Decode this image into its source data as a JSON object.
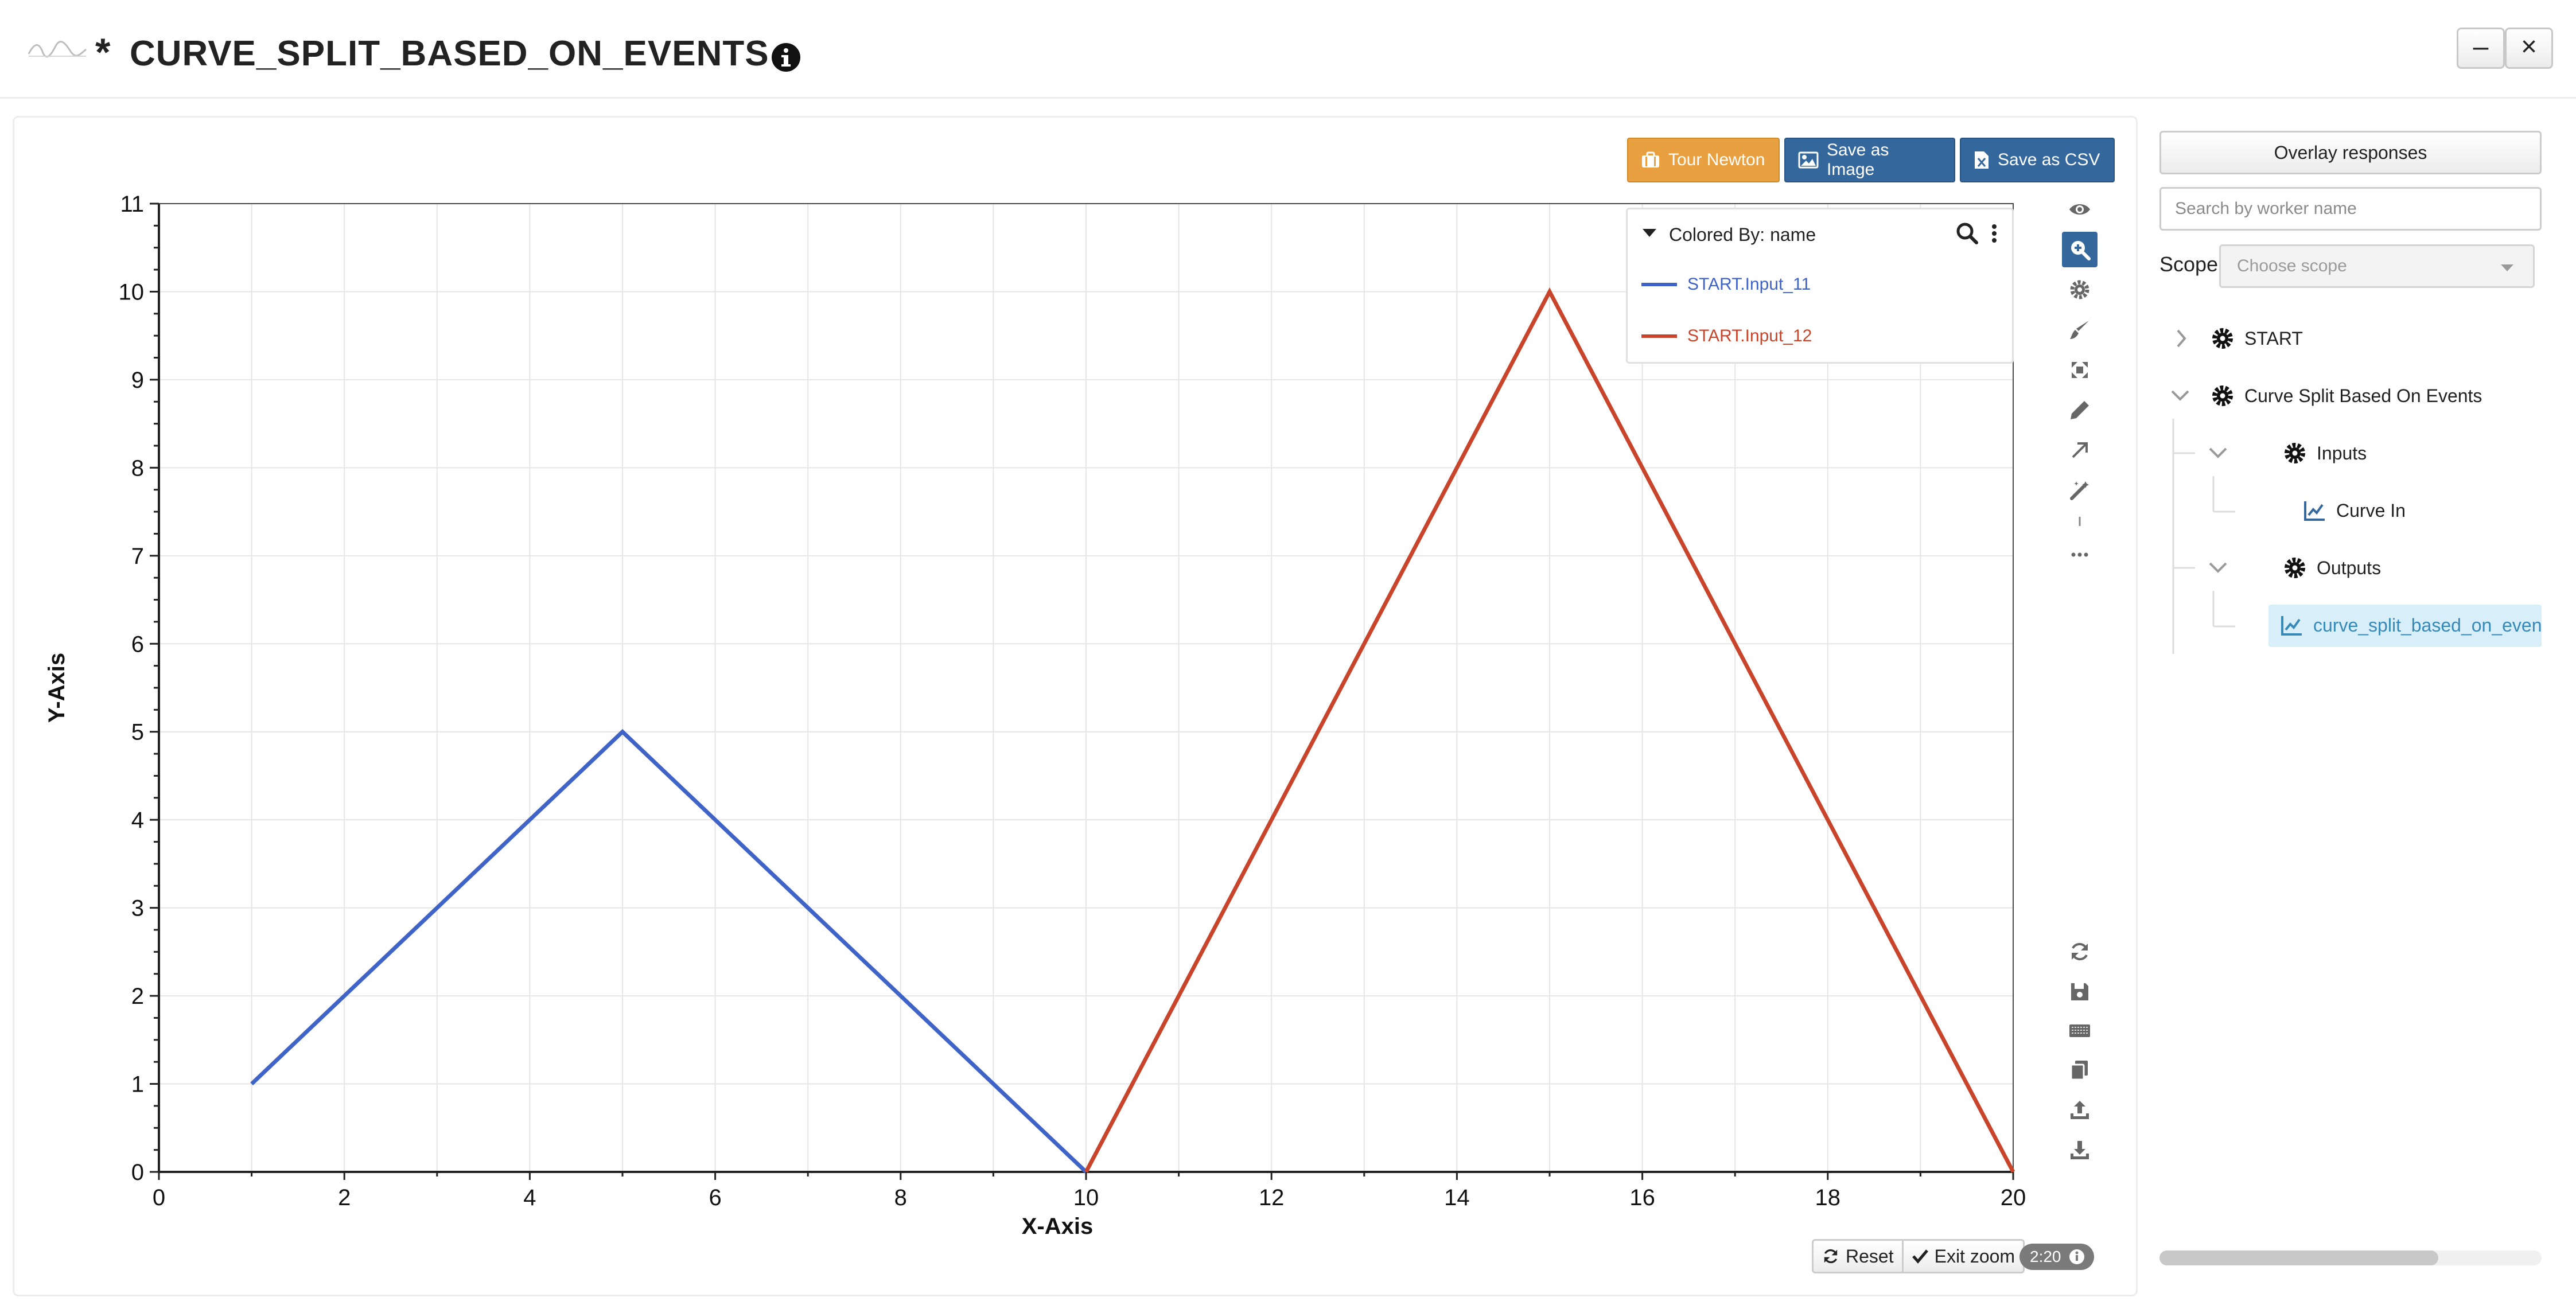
{
  "header": {
    "star": "*",
    "title": "CURVE_SPLIT_BASED_ON_EVENTS",
    "minimize_label": "–",
    "close_label": "×"
  },
  "toolbar": {
    "tour_label": "Tour Newton",
    "save_image_label": "Save as Image",
    "save_csv_label": "Save as CSV"
  },
  "chart_bottom": {
    "reset_label": "Reset",
    "exit_zoom_label": "Exit zoom",
    "counter": "2:20"
  },
  "chart_data": {
    "type": "line",
    "xlabel": "X-Axis",
    "ylabel": "Y-Axis",
    "xlim": [
      0,
      20
    ],
    "ylim": [
      0,
      11
    ],
    "x_ticks": [
      0,
      2,
      4,
      6,
      8,
      10,
      12,
      14,
      16,
      18,
      20
    ],
    "y_ticks": [
      0,
      1,
      2,
      3,
      4,
      5,
      6,
      7,
      8,
      9,
      10,
      11
    ],
    "grid": true,
    "legend": {
      "title": "Colored By: name",
      "placement": "top-right"
    },
    "series": [
      {
        "name": "START.Input_11",
        "color": "#3f63c6",
        "x": [
          1,
          5,
          10
        ],
        "y": [
          1,
          5,
          0
        ]
      },
      {
        "name": "START.Input_12",
        "color": "#c8442b",
        "x": [
          10,
          15,
          20
        ],
        "y": [
          0,
          10,
          0
        ]
      }
    ]
  },
  "sidebar": {
    "overlay_label": "Overlay responses",
    "search_placeholder": "Search by worker name",
    "scope_label": "Scope:",
    "scope_placeholder": "Choose scope",
    "tree": {
      "start": "START",
      "worker": "Curve Split Based On Events",
      "inputs": "Inputs",
      "curve_in": "Curve In",
      "outputs": "Outputs",
      "output_item": "curve_split_based_on_events"
    }
  },
  "colors": {
    "primary": "#34679c",
    "tour": "#e8a040",
    "series_1": "#3f63c6",
    "series_2": "#c8442b",
    "selection": "#d8eef8"
  }
}
